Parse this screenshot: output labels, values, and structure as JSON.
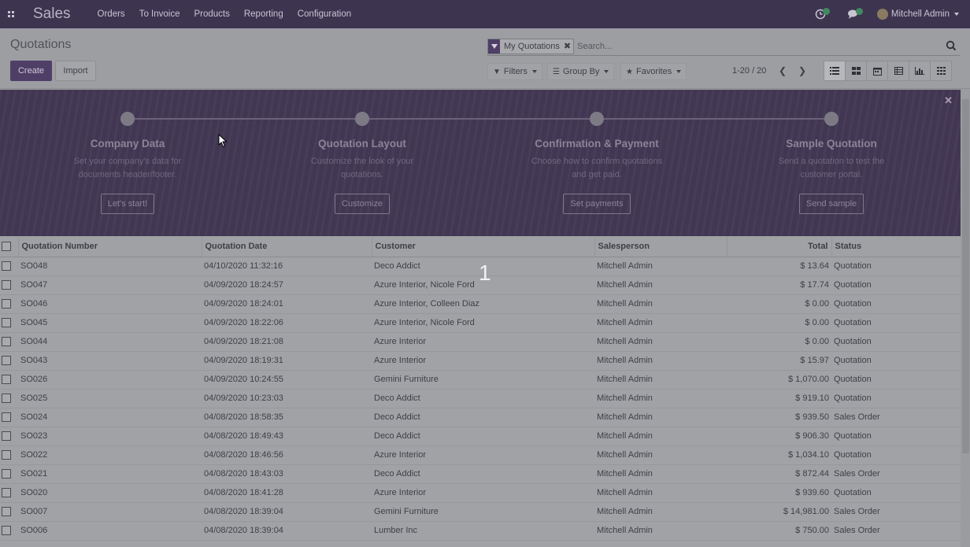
{
  "navbar": {
    "brand": "Sales",
    "menu": [
      "Orders",
      "To Invoice",
      "Products",
      "Reporting",
      "Configuration"
    ],
    "user": "Mitchell Admin"
  },
  "control": {
    "title": "Quotations",
    "create": "Create",
    "import": "Import",
    "facet": "My Quotations",
    "search_placeholder": "Search...",
    "filters": "Filters",
    "groupby": "Group By",
    "favorites": "Favorites",
    "pager": "1-20 / 20"
  },
  "onboarding": {
    "steps": [
      {
        "title": "Company Data",
        "desc": "Set your company's data for documents header/footer.",
        "button": "Let's start!"
      },
      {
        "title": "Quotation Layout",
        "desc": "Customize the look of your quotations.",
        "button": "Customize"
      },
      {
        "title": "Confirmation & Payment",
        "desc": "Choose how to confirm quotations and get paid.",
        "button": "Set payments"
      },
      {
        "title": "Sample Quotation",
        "desc": "Send a quotation to test the customer portal.",
        "button": "Send sample"
      }
    ]
  },
  "table": {
    "headers": [
      "Quotation Number",
      "Quotation Date",
      "Customer",
      "Salesperson",
      "Total",
      "Status"
    ],
    "rows": [
      [
        "SO048",
        "04/10/2020 11:32:16",
        "Deco Addict",
        "Mitchell Admin",
        "$ 13.64",
        "Quotation"
      ],
      [
        "SO047",
        "04/09/2020 18:24:57",
        "Azure Interior, Nicole Ford",
        "Mitchell Admin",
        "$ 17.74",
        "Quotation"
      ],
      [
        "SO046",
        "04/09/2020 18:24:01",
        "Azure Interior, Colleen Diaz",
        "Mitchell Admin",
        "$ 0.00",
        "Quotation"
      ],
      [
        "SO045",
        "04/09/2020 18:22:06",
        "Azure Interior, Nicole Ford",
        "Mitchell Admin",
        "$ 0.00",
        "Quotation"
      ],
      [
        "SO044",
        "04/09/2020 18:21:08",
        "Azure Interior",
        "Mitchell Admin",
        "$ 0.00",
        "Quotation"
      ],
      [
        "SO043",
        "04/09/2020 18:19:31",
        "Azure Interior",
        "Mitchell Admin",
        "$ 15.97",
        "Quotation"
      ],
      [
        "SO026",
        "04/09/2020 10:24:55",
        "Gemini Furniture",
        "Mitchell Admin",
        "$ 1,070.00",
        "Quotation"
      ],
      [
        "SO025",
        "04/09/2020 10:23:03",
        "Deco Addict",
        "Mitchell Admin",
        "$ 919.10",
        "Quotation"
      ],
      [
        "SO024",
        "04/08/2020 18:58:35",
        "Deco Addict",
        "Mitchell Admin",
        "$ 939.50",
        "Sales Order"
      ],
      [
        "SO023",
        "04/08/2020 18:49:43",
        "Deco Addict",
        "Mitchell Admin",
        "$ 906.30",
        "Quotation"
      ],
      [
        "SO022",
        "04/08/2020 18:46:56",
        "Azure Interior",
        "Mitchell Admin",
        "$ 1,034.10",
        "Quotation"
      ],
      [
        "SO021",
        "04/08/2020 18:43:03",
        "Deco Addict",
        "Mitchell Admin",
        "$ 872.44",
        "Sales Order"
      ],
      [
        "SO020",
        "04/08/2020 18:41:28",
        "Azure Interior",
        "Mitchell Admin",
        "$ 939.60",
        "Quotation"
      ],
      [
        "SO007",
        "04/08/2020 18:39:04",
        "Gemini Furniture",
        "Mitchell Admin",
        "$ 14,981.00",
        "Sales Order"
      ],
      [
        "SO006",
        "04/08/2020 18:39:04",
        "Lumber Inc",
        "Mitchell Admin",
        "$ 750.00",
        "Sales Order"
      ]
    ]
  },
  "overlay": {
    "step_number": "1"
  }
}
